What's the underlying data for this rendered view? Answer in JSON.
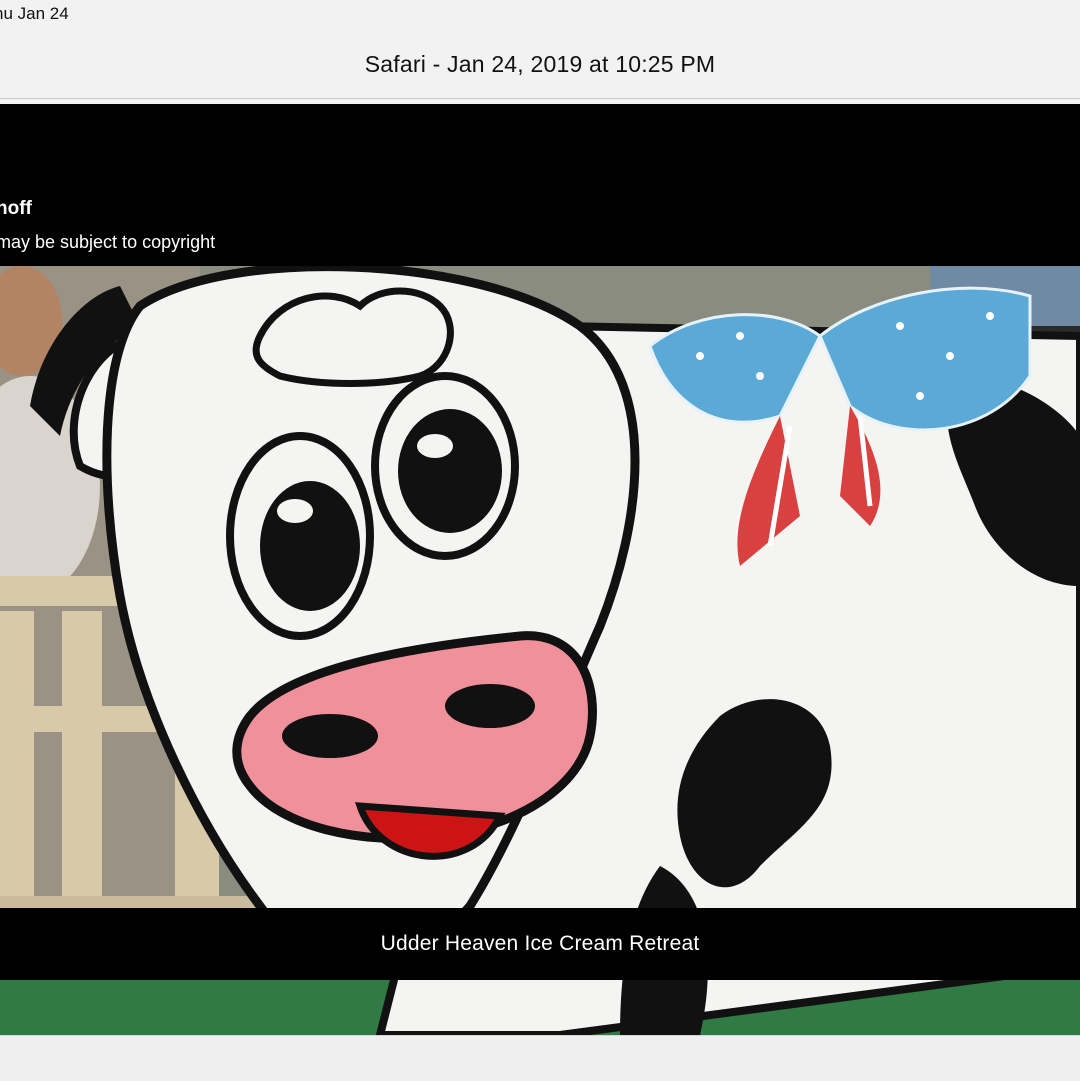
{
  "status_bar": {
    "date_text": "hu Jan 24"
  },
  "window": {
    "title": "Safari - Jan 24, 2019 at 10:25 PM"
  },
  "image_viewer": {
    "author_fragment": "noff",
    "copyright_notice": "may be subject to copyright",
    "caption": "Udder Heaven Ice Cream Retreat"
  },
  "colors": {
    "frame_background": "#000000",
    "chrome_background": "#f2f2f2",
    "cow_nose": "#f0909a",
    "cow_tongue": "#cc1414",
    "bow_blue": "#5aa9d6"
  }
}
